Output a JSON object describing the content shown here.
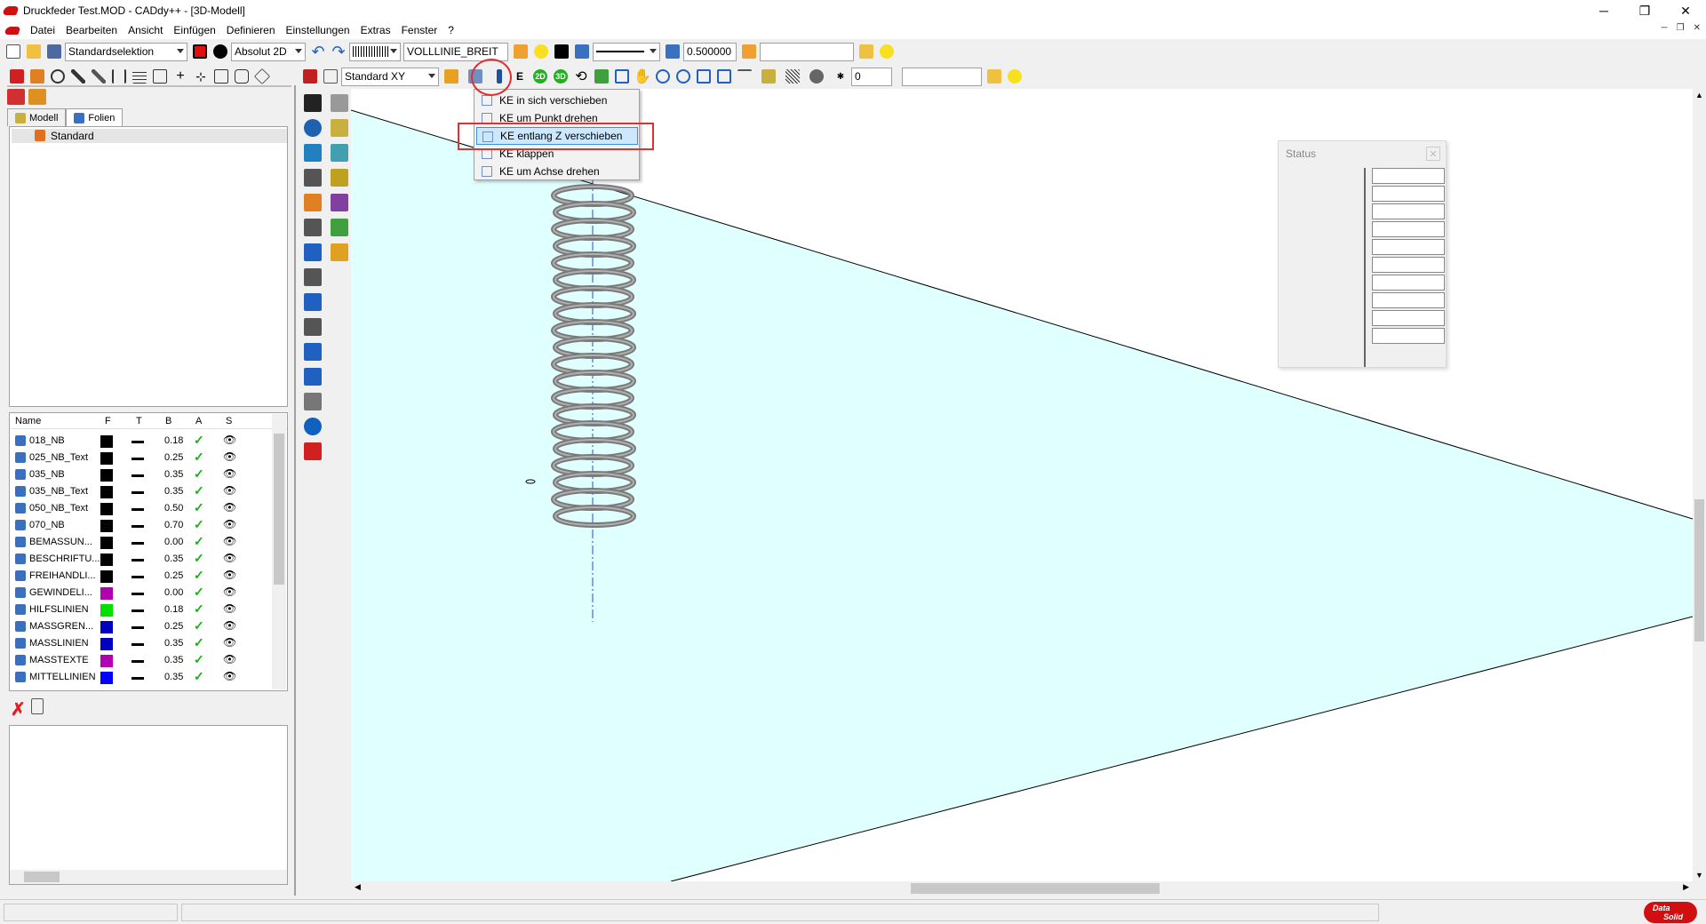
{
  "window": {
    "title": "Druckfeder Test.MOD  -  CADdy++ - [3D-Modell]",
    "min": "─",
    "max": "❐",
    "close": "✕"
  },
  "menu": [
    "Datei",
    "Bearbeiten",
    "Ansicht",
    "Einfügen",
    "Definieren",
    "Einstellungen",
    "Extras",
    "Fenster",
    "?"
  ],
  "toolbar1": {
    "selection_mode": "Standardselektion",
    "coord_mode": "Absolut 2D",
    "line_type": "VOLLLINIE_BREIT",
    "line_width": "0.500000",
    "extra_field": ""
  },
  "toolbar2": {
    "view": "Standard XY",
    "layer_count": "0",
    "extra_field": "",
    "btn_2d": "2D",
    "btn_3d": "3D"
  },
  "tabs": {
    "model": "Modell",
    "folien": "Folien"
  },
  "tree": {
    "item": "Standard"
  },
  "layers": {
    "headers": {
      "name": "Name",
      "f": "F",
      "t": "T",
      "b": "B",
      "a": "A",
      "s": "S"
    },
    "rows": [
      {
        "name": "018_NB",
        "color": "#000000",
        "b": "0.18"
      },
      {
        "name": "025_NB_Text",
        "color": "#000000",
        "b": "0.25"
      },
      {
        "name": "035_NB",
        "color": "#000000",
        "b": "0.35"
      },
      {
        "name": "035_NB_Text",
        "color": "#000000",
        "b": "0.35"
      },
      {
        "name": "050_NB_Text",
        "color": "#000000",
        "b": "0.50"
      },
      {
        "name": "070_NB",
        "color": "#000000",
        "b": "0.70"
      },
      {
        "name": "BEMASSUN...",
        "color": "#000000",
        "b": "0.00"
      },
      {
        "name": "BESCHRIFTU...",
        "color": "#000000",
        "b": "0.35"
      },
      {
        "name": "FREIHANDLI...",
        "color": "#000000",
        "b": "0.25"
      },
      {
        "name": "GEWINDELI...",
        "color": "#b000b0",
        "b": "0.00"
      },
      {
        "name": "HILFSLINIEN",
        "color": "#00e000",
        "b": "0.18"
      },
      {
        "name": "MASSGREN...",
        "color": "#0000c0",
        "b": "0.25"
      },
      {
        "name": "MASSLINIEN",
        "color": "#0000c0",
        "b": "0.35"
      },
      {
        "name": "MASSTEXTE",
        "color": "#b000b0",
        "b": "0.35"
      },
      {
        "name": "MITTELLINIEN",
        "color": "#0000ff",
        "b": "0.35"
      }
    ]
  },
  "dropdown": {
    "items": [
      "KE in sich verschieben",
      "KE um Punkt drehen",
      "KE entlang Z verschieben",
      "KE klappen",
      "KE um Achse drehen"
    ],
    "highlighted_index": 2
  },
  "status_window": {
    "title": "Status",
    "close": "✕",
    "cells": [
      "",
      "",
      "",
      "",
      "",
      "",
      "",
      "",
      "",
      ""
    ]
  },
  "colors": {
    "plane_fill": "#e0ffff",
    "spring": "#7a7a7a",
    "accent_red": "#e03030",
    "highlight": "#cce8ff"
  },
  "brand": {
    "logo_text_1": "Data",
    "logo_text_2": "Solid"
  }
}
